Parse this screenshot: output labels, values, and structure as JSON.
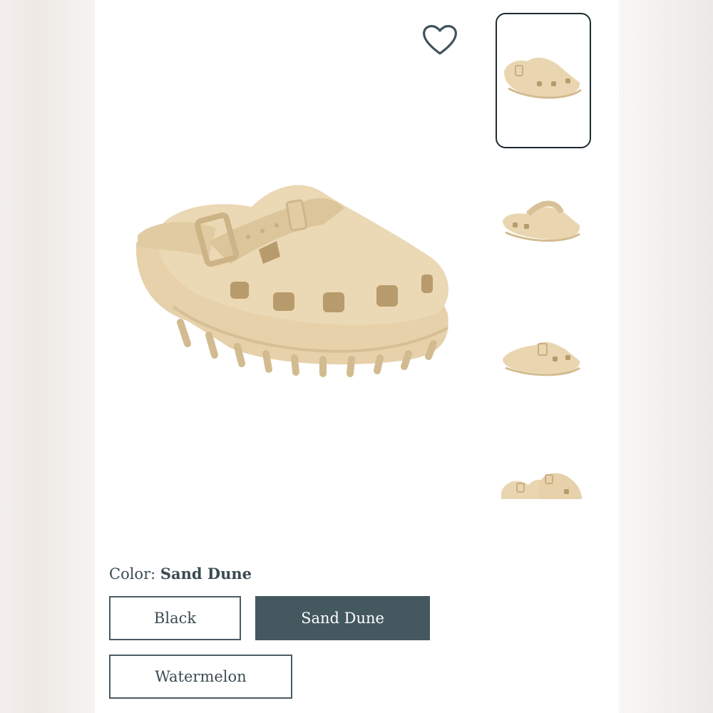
{
  "product": {
    "favorite_icon": "heart-outline-icon",
    "main_image_alt": "sand clog with buckle strap",
    "thumbnail_count": 4,
    "selected_thumbnail": 1
  },
  "color": {
    "label": "Color:",
    "selected": "Sand Dune",
    "options": [
      "Black",
      "Sand Dune",
      "Watermelon"
    ]
  },
  "colors": {
    "shoe": "#e9d6b1",
    "shoe_shade": "#d8c196",
    "shoe_dark": "#c9ae80",
    "accent": "#43585f",
    "text": "#3c4b52"
  }
}
